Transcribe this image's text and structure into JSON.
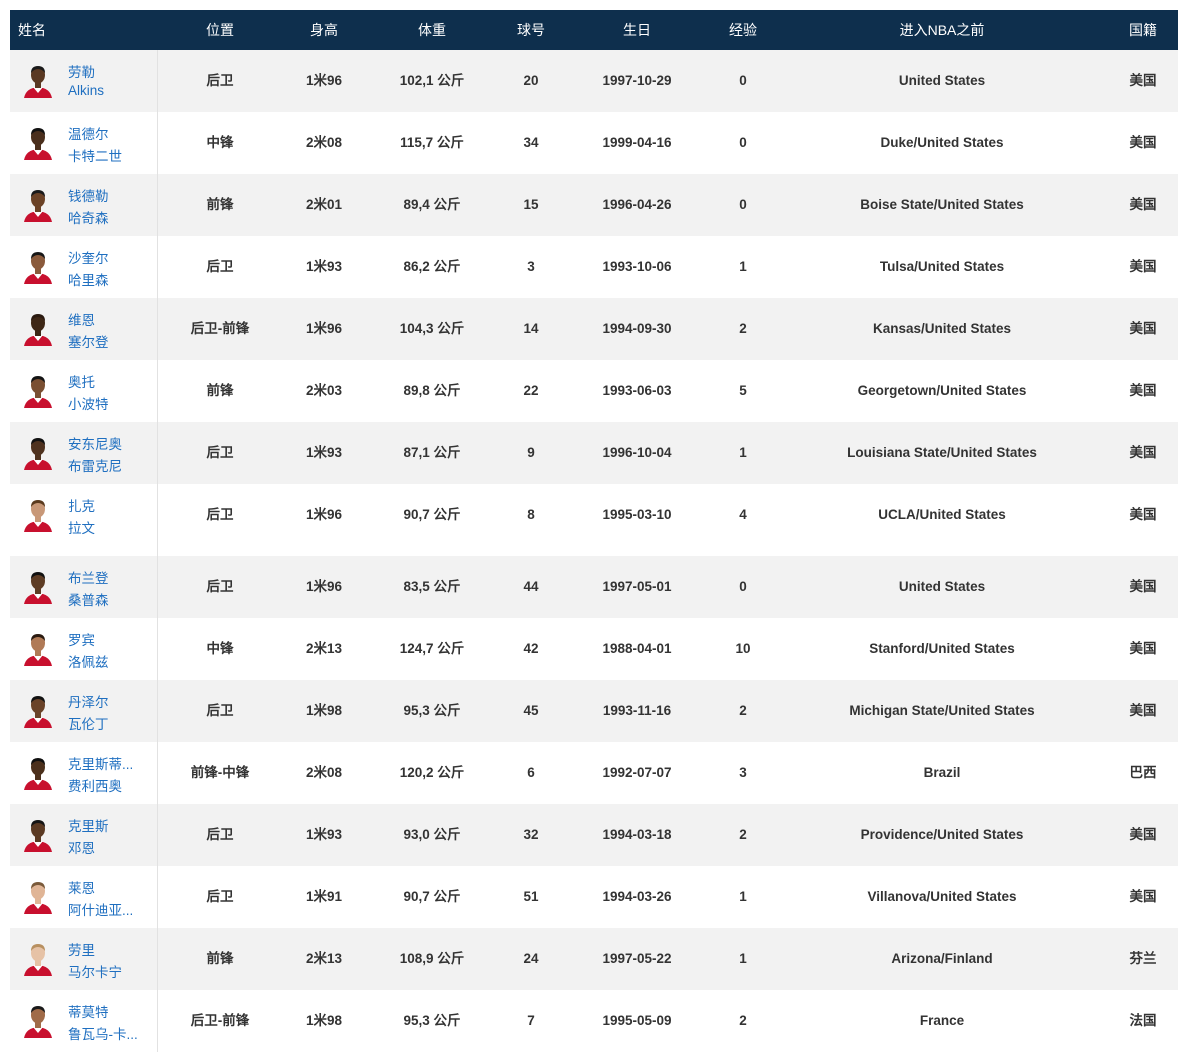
{
  "table": {
    "headers": {
      "name": "姓名",
      "position": "位置",
      "height": "身高",
      "weight": "体重",
      "number": "球号",
      "birthday": "生日",
      "experience": "经验",
      "pre_nba": "进入NBA之前",
      "nationality": "国籍"
    },
    "colors": {
      "header_bg": "#0e2f4d",
      "link": "#1f6fc0",
      "stripe": "#f2f2f2",
      "jersey": "#c8102e"
    },
    "group1": [
      {
        "first": "劳勒",
        "last": "Alkins",
        "position": "后卫",
        "height": "1米96",
        "weight": "102,1 公斤",
        "number": "20",
        "birthday": "1997-10-29",
        "experience": "0",
        "pre_nba": "United States",
        "nationality": "美国"
      },
      {
        "first": "温德尔",
        "last": "卡特二世",
        "position": "中锋",
        "height": "2米08",
        "weight": "115,7 公斤",
        "number": "34",
        "birthday": "1999-04-16",
        "experience": "0",
        "pre_nba": "Duke/United States",
        "nationality": "美国"
      },
      {
        "first": "钱德勒",
        "last": "哈奇森",
        "position": "前锋",
        "height": "2米01",
        "weight": "89,4 公斤",
        "number": "15",
        "birthday": "1996-04-26",
        "experience": "0",
        "pre_nba": "Boise State/United States",
        "nationality": "美国"
      },
      {
        "first": "沙奎尔",
        "last": "哈里森",
        "position": "后卫",
        "height": "1米93",
        "weight": "86,2 公斤",
        "number": "3",
        "birthday": "1993-10-06",
        "experience": "1",
        "pre_nba": "Tulsa/United States",
        "nationality": "美国"
      },
      {
        "first": "维恩",
        "last": "塞尔登",
        "position": "后卫-前锋",
        "height": "1米96",
        "weight": "104,3 公斤",
        "number": "14",
        "birthday": "1994-09-30",
        "experience": "2",
        "pre_nba": "Kansas/United States",
        "nationality": "美国"
      },
      {
        "first": "奥托",
        "last": "小波特",
        "position": "前锋",
        "height": "2米03",
        "weight": "89,8 公斤",
        "number": "22",
        "birthday": "1993-06-03",
        "experience": "5",
        "pre_nba": "Georgetown/United States",
        "nationality": "美国"
      },
      {
        "first": "安东尼奥",
        "last": "布雷克尼",
        "position": "后卫",
        "height": "1米93",
        "weight": "87,1 公斤",
        "number": "9",
        "birthday": "1996-10-04",
        "experience": "1",
        "pre_nba": "Louisiana State/United States",
        "nationality": "美国"
      },
      {
        "first": "扎克",
        "last": "拉文",
        "position": "后卫",
        "height": "1米96",
        "weight": "90,7 公斤",
        "number": "8",
        "birthday": "1995-03-10",
        "experience": "4",
        "pre_nba": "UCLA/United States",
        "nationality": "美国"
      }
    ],
    "group2": [
      {
        "first": "布兰登",
        "last": "桑普森",
        "position": "后卫",
        "height": "1米96",
        "weight": "83,5 公斤",
        "number": "44",
        "birthday": "1997-05-01",
        "experience": "0",
        "pre_nba": "United States",
        "nationality": "美国"
      },
      {
        "first": "罗宾",
        "last": "洛佩兹",
        "position": "中锋",
        "height": "2米13",
        "weight": "124,7 公斤",
        "number": "42",
        "birthday": "1988-04-01",
        "experience": "10",
        "pre_nba": "Stanford/United States",
        "nationality": "美国"
      },
      {
        "first": "丹泽尔",
        "last": "瓦伦丁",
        "position": "后卫",
        "height": "1米98",
        "weight": "95,3 公斤",
        "number": "45",
        "birthday": "1993-11-16",
        "experience": "2",
        "pre_nba": "Michigan State/United States",
        "nationality": "美国"
      },
      {
        "first": "克里斯蒂...",
        "last": "费利西奥",
        "position": "前锋-中锋",
        "height": "2米08",
        "weight": "120,2 公斤",
        "number": "6",
        "birthday": "1992-07-07",
        "experience": "3",
        "pre_nba": "Brazil",
        "nationality": "巴西"
      },
      {
        "first": "克里斯",
        "last": "邓恩",
        "position": "后卫",
        "height": "1米93",
        "weight": "93,0 公斤",
        "number": "32",
        "birthday": "1994-03-18",
        "experience": "2",
        "pre_nba": "Providence/United States",
        "nationality": "美国"
      },
      {
        "first": "莱恩",
        "last": "阿什迪亚...",
        "position": "后卫",
        "height": "1米91",
        "weight": "90,7 公斤",
        "number": "51",
        "birthday": "1994-03-26",
        "experience": "1",
        "pre_nba": "Villanova/United States",
        "nationality": "美国"
      },
      {
        "first": "劳里",
        "last": "马尔卡宁",
        "position": "前锋",
        "height": "2米13",
        "weight": "108,9 公斤",
        "number": "24",
        "birthday": "1997-05-22",
        "experience": "1",
        "pre_nba": "Arizona/Finland",
        "nationality": "芬兰"
      },
      {
        "first": "蒂莫特",
        "last": "鲁瓦乌-卡...",
        "position": "后卫-前锋",
        "height": "1米98",
        "weight": "95,3 公斤",
        "number": "7",
        "birthday": "1995-05-09",
        "experience": "2",
        "pre_nba": "France",
        "nationality": "法国"
      }
    ]
  }
}
